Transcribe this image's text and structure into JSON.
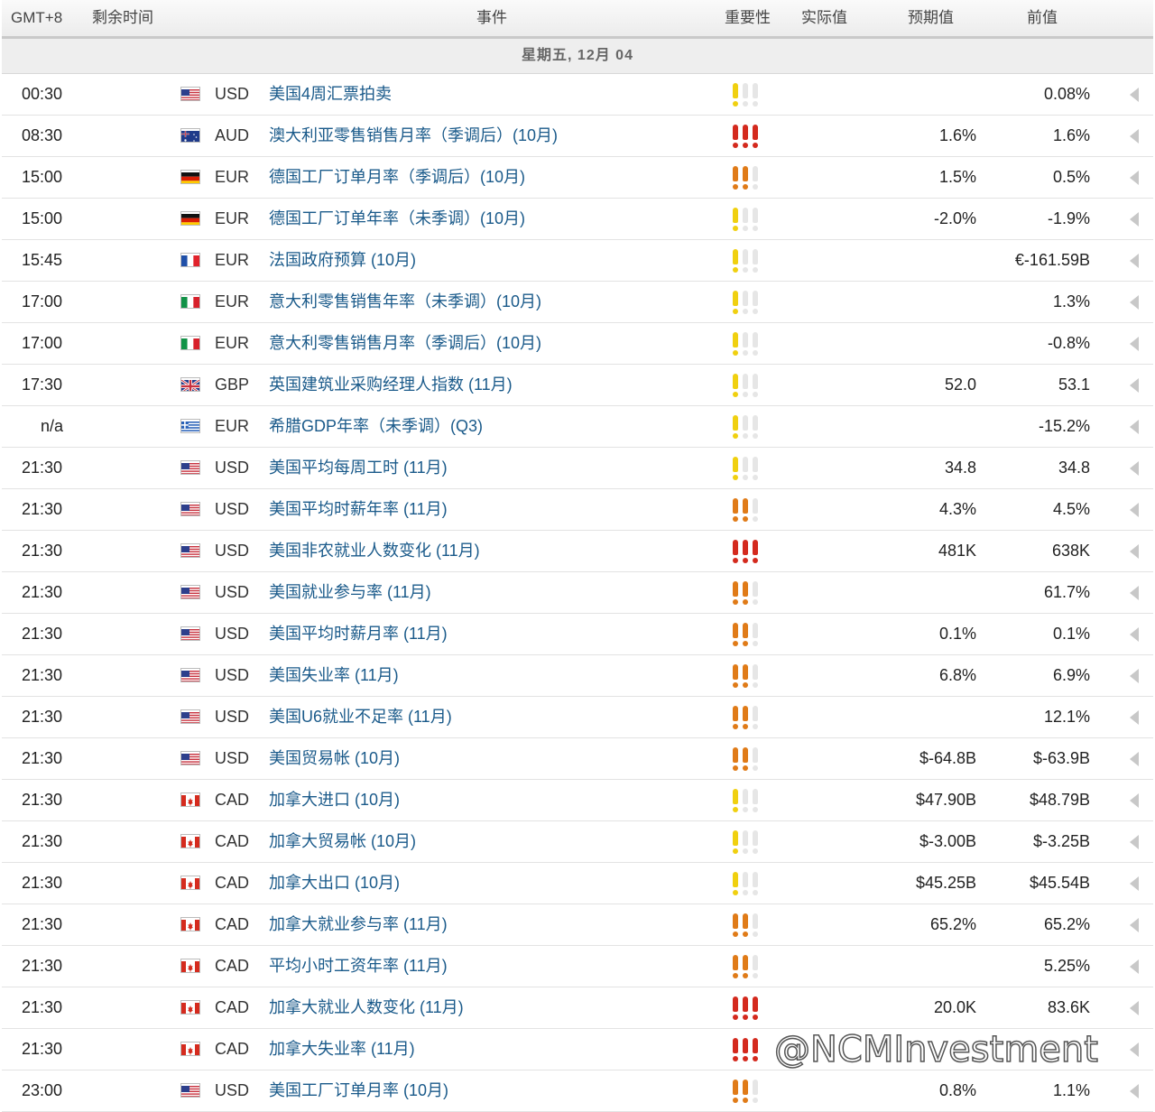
{
  "header": {
    "timezone": "GMT+8",
    "time_left": "剩余时间",
    "event": "事件",
    "importance": "重要性",
    "actual": "实际值",
    "forecast": "预期值",
    "previous": "前值"
  },
  "day": "星期五, 12月 04",
  "watermark": "@NCMInvestment",
  "colors": {
    "high": "#d42a1e",
    "medium": "#e07b18",
    "low": "#f0d010",
    "inactive": "#e6e6e6",
    "event_link": "#1a5a8a"
  },
  "events": [
    {
      "time": "00:30",
      "flag": "us",
      "currency": "USD",
      "event": "美国4周汇票拍卖",
      "importance": 1,
      "forecast": "",
      "previous": "0.08%"
    },
    {
      "time": "08:30",
      "flag": "au",
      "currency": "AUD",
      "event": "澳大利亚零售销售月率（季调后）(10月)",
      "importance": 3,
      "forecast": "1.6%",
      "previous": "1.6%"
    },
    {
      "time": "15:00",
      "flag": "de",
      "currency": "EUR",
      "event": "德国工厂订单月率（季调后）(10月)",
      "importance": 2,
      "forecast": "1.5%",
      "previous": "0.5%"
    },
    {
      "time": "15:00",
      "flag": "de",
      "currency": "EUR",
      "event": "德国工厂订单年率（未季调）(10月)",
      "importance": 1,
      "forecast": "-2.0%",
      "previous": "-1.9%"
    },
    {
      "time": "15:45",
      "flag": "fr",
      "currency": "EUR",
      "event": "法国政府预算 (10月)",
      "importance": 1,
      "forecast": "",
      "previous": "€-161.59B"
    },
    {
      "time": "17:00",
      "flag": "it",
      "currency": "EUR",
      "event": "意大利零售销售年率（未季调）(10月)",
      "importance": 1,
      "forecast": "",
      "previous": "1.3%"
    },
    {
      "time": "17:00",
      "flag": "it",
      "currency": "EUR",
      "event": "意大利零售销售月率（季调后）(10月)",
      "importance": 1,
      "forecast": "",
      "previous": "-0.8%"
    },
    {
      "time": "17:30",
      "flag": "gb",
      "currency": "GBP",
      "event": "英国建筑业采购经理人指数 (11月)",
      "importance": 1,
      "forecast": "52.0",
      "previous": "53.1"
    },
    {
      "time": "n/a",
      "flag": "gr",
      "currency": "EUR",
      "event": "希腊GDP年率（未季调）(Q3)",
      "importance": 1,
      "forecast": "",
      "previous": "-15.2%"
    },
    {
      "time": "21:30",
      "flag": "us",
      "currency": "USD",
      "event": "美国平均每周工时 (11月)",
      "importance": 1,
      "forecast": "34.8",
      "previous": "34.8"
    },
    {
      "time": "21:30",
      "flag": "us",
      "currency": "USD",
      "event": "美国平均时薪年率 (11月)",
      "importance": 2,
      "forecast": "4.3%",
      "previous": "4.5%"
    },
    {
      "time": "21:30",
      "flag": "us",
      "currency": "USD",
      "event": "美国非农就业人数变化 (11月)",
      "importance": 3,
      "forecast": "481K",
      "previous": "638K"
    },
    {
      "time": "21:30",
      "flag": "us",
      "currency": "USD",
      "event": "美国就业参与率 (11月)",
      "importance": 2,
      "forecast": "",
      "previous": "61.7%"
    },
    {
      "time": "21:30",
      "flag": "us",
      "currency": "USD",
      "event": "美国平均时薪月率 (11月)",
      "importance": 2,
      "forecast": "0.1%",
      "previous": "0.1%"
    },
    {
      "time": "21:30",
      "flag": "us",
      "currency": "USD",
      "event": "美国失业率 (11月)",
      "importance": 2,
      "forecast": "6.8%",
      "previous": "6.9%"
    },
    {
      "time": "21:30",
      "flag": "us",
      "currency": "USD",
      "event": "美国U6就业不足率 (11月)",
      "importance": 2,
      "forecast": "",
      "previous": "12.1%"
    },
    {
      "time": "21:30",
      "flag": "us",
      "currency": "USD",
      "event": "美国贸易帐 (10月)",
      "importance": 2,
      "forecast": "$-64.8B",
      "previous": "$-63.9B"
    },
    {
      "time": "21:30",
      "flag": "ca",
      "currency": "CAD",
      "event": "加拿大进口 (10月)",
      "importance": 1,
      "forecast": "$47.90B",
      "previous": "$48.79B"
    },
    {
      "time": "21:30",
      "flag": "ca",
      "currency": "CAD",
      "event": "加拿大贸易帐 (10月)",
      "importance": 1,
      "forecast": "$-3.00B",
      "previous": "$-3.25B"
    },
    {
      "time": "21:30",
      "flag": "ca",
      "currency": "CAD",
      "event": "加拿大出口 (10月)",
      "importance": 1,
      "forecast": "$45.25B",
      "previous": "$45.54B"
    },
    {
      "time": "21:30",
      "flag": "ca",
      "currency": "CAD",
      "event": "加拿大就业参与率 (11月)",
      "importance": 2,
      "forecast": "65.2%",
      "previous": "65.2%"
    },
    {
      "time": "21:30",
      "flag": "ca",
      "currency": "CAD",
      "event": "平均小时工资年率 (11月)",
      "importance": 2,
      "forecast": "",
      "previous": "5.25%"
    },
    {
      "time": "21:30",
      "flag": "ca",
      "currency": "CAD",
      "event": "加拿大就业人数变化 (11月)",
      "importance": 3,
      "forecast": "20.0K",
      "previous": "83.6K"
    },
    {
      "time": "21:30",
      "flag": "ca",
      "currency": "CAD",
      "event": "加拿大失业率 (11月)",
      "importance": 3,
      "forecast": "",
      "previous": ""
    },
    {
      "time": "23:00",
      "flag": "us",
      "currency": "USD",
      "event": "美国工厂订单月率 (10月)",
      "importance": 2,
      "forecast": "0.8%",
      "previous": "1.1%"
    }
  ]
}
